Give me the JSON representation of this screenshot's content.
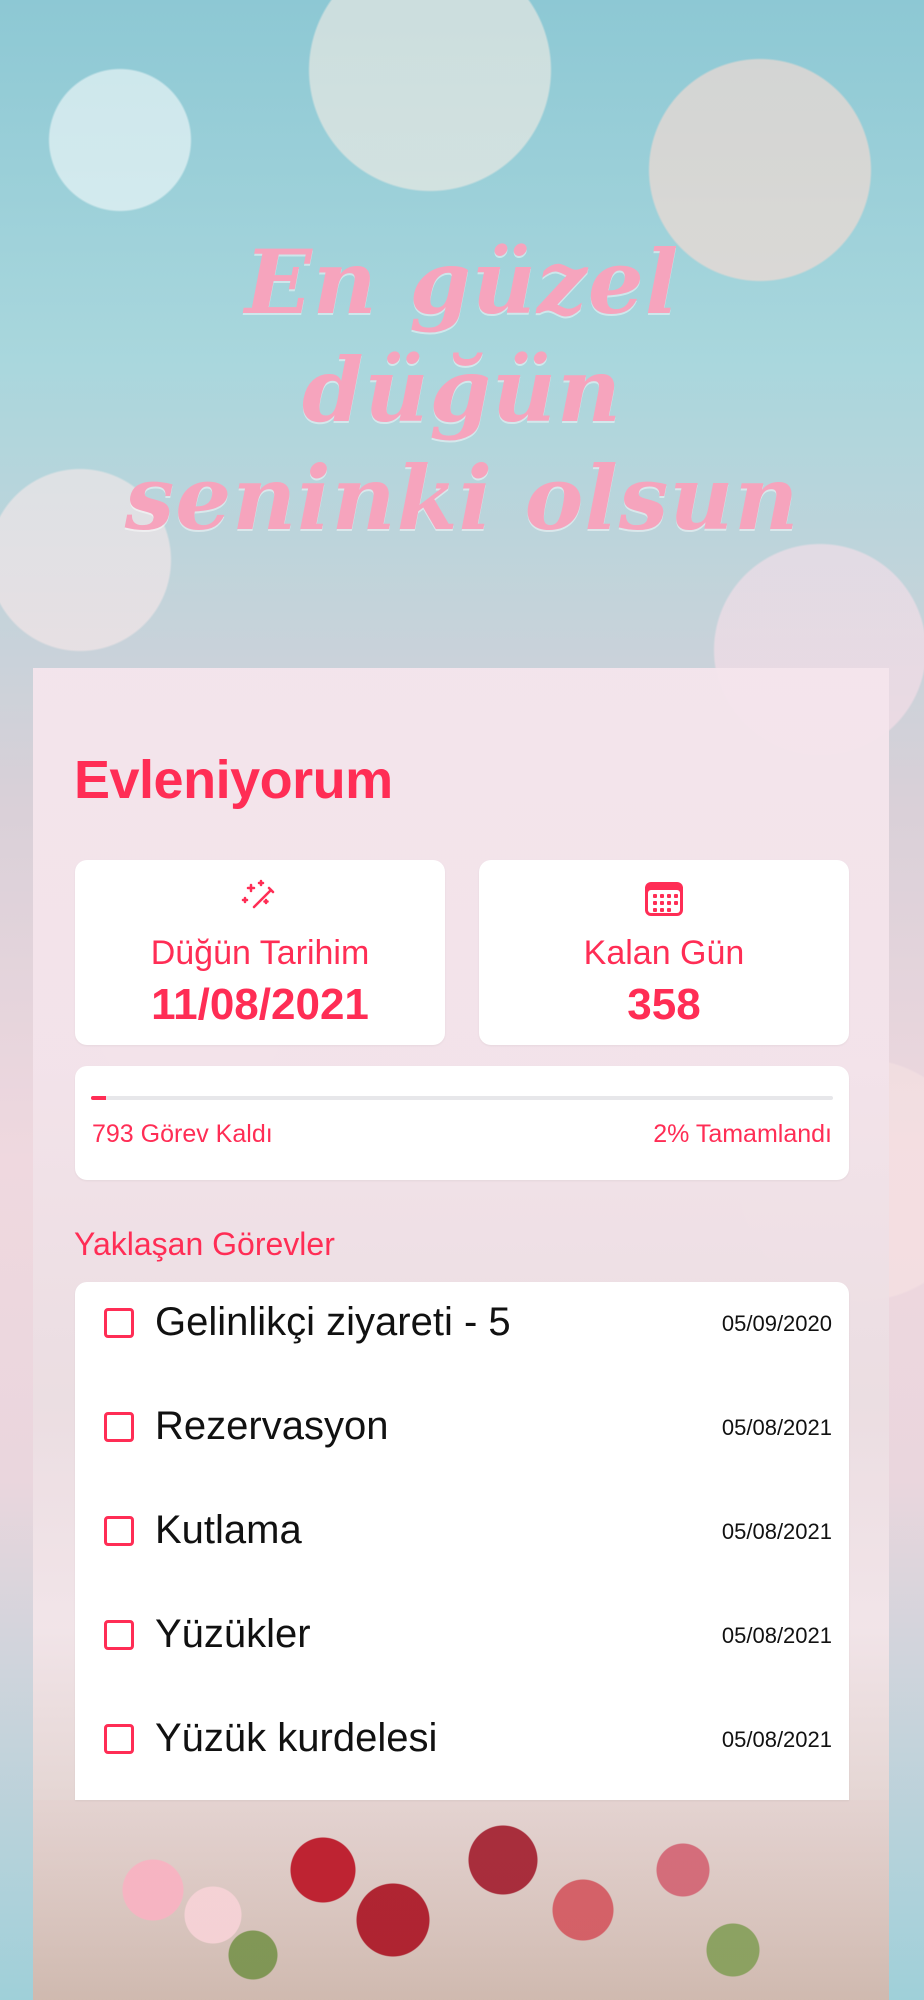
{
  "hero": {
    "title": "En güzel düğün\nseninki olsun"
  },
  "app": {
    "title": "Evleniyorum"
  },
  "summary": {
    "wedding_date_label": "Düğün Tarihim",
    "wedding_date_value": "11/08/2021",
    "days_left_label": "Kalan Gün",
    "days_left_value": "358"
  },
  "progress": {
    "remaining_text": "793 Görev Kaldı",
    "completed_text": "2% Tamamlandı",
    "percent": 2
  },
  "upcoming": {
    "title": "Yaklaşan Görevler",
    "tasks": [
      {
        "label": "Gelinlikçi ziyareti - 5",
        "date": "05/09/2020"
      },
      {
        "label": "Rezervasyon",
        "date": "05/08/2021"
      },
      {
        "label": "Kutlama",
        "date": "05/08/2021"
      },
      {
        "label": "Yüzükler",
        "date": "05/08/2021"
      },
      {
        "label": "Yüzük kurdelesi",
        "date": "05/08/2021"
      }
    ]
  },
  "icons": {
    "wedding_date": "magic-wand-icon",
    "days_left": "calendar-icon"
  },
  "colors": {
    "accent": "#ff2d55",
    "hero_text": "#f6a4bd",
    "card_background": "#ffffff"
  }
}
